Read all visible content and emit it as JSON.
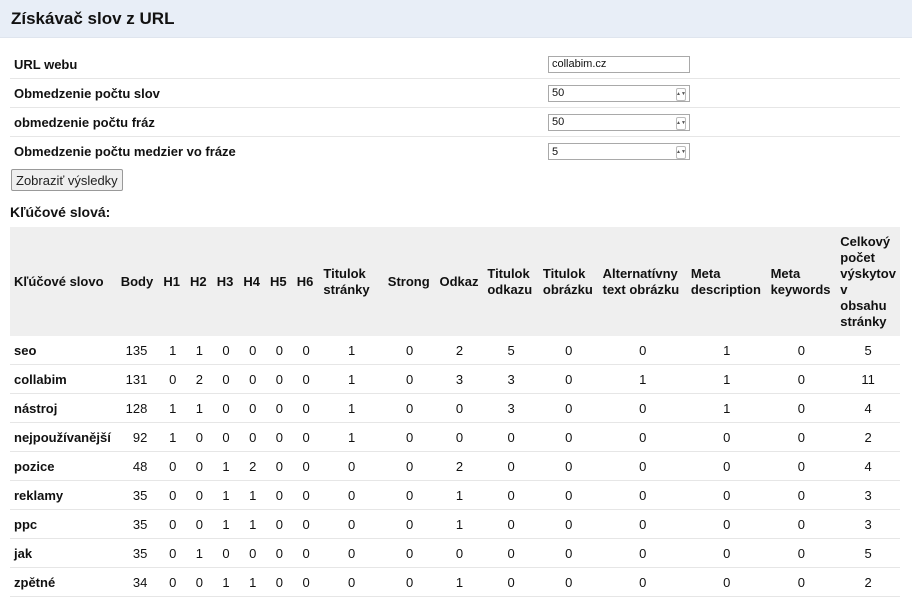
{
  "app": {
    "title": "Získávač slov z URL"
  },
  "form": {
    "rows": [
      {
        "label": "URL webu",
        "value": "collabim.cz",
        "spinner": false
      },
      {
        "label": "Obmedzenie počtu slov",
        "value": "50",
        "spinner": true
      },
      {
        "label": "obmedzenie počtu fráz",
        "value": "50",
        "spinner": true
      },
      {
        "label": "Obmedzenie počtu medzier vo fráze",
        "value": "5",
        "spinner": true
      }
    ],
    "submit_label": "Zobraziť výsledky"
  },
  "keywords": {
    "title": "Kľúčové slová:",
    "columns": [
      "Kľúčové slovo",
      "Body",
      "H1",
      "H2",
      "H3",
      "H4",
      "H5",
      "H6",
      "Titulok stránky",
      "Strong",
      "Odkaz",
      "Titulok odkazu",
      "Titulok obrázku",
      "Alternatívny text obrázku",
      "Meta description",
      "Meta keywords",
      "Celkový počet výskytov v obsahu stránky"
    ],
    "rows": [
      [
        "seo",
        "135",
        "1",
        "1",
        "0",
        "0",
        "0",
        "0",
        "1",
        "0",
        "2",
        "5",
        "0",
        "0",
        "1",
        "0",
        "5"
      ],
      [
        "collabim",
        "131",
        "0",
        "2",
        "0",
        "0",
        "0",
        "0",
        "1",
        "0",
        "3",
        "3",
        "0",
        "1",
        "1",
        "0",
        "11"
      ],
      [
        "nástroj",
        "128",
        "1",
        "1",
        "0",
        "0",
        "0",
        "0",
        "1",
        "0",
        "0",
        "3",
        "0",
        "0",
        "1",
        "0",
        "4"
      ],
      [
        "nejpoužívanější",
        "92",
        "1",
        "0",
        "0",
        "0",
        "0",
        "0",
        "1",
        "0",
        "0",
        "0",
        "0",
        "0",
        "0",
        "0",
        "2"
      ],
      [
        "pozice",
        "48",
        "0",
        "0",
        "1",
        "2",
        "0",
        "0",
        "0",
        "0",
        "2",
        "0",
        "0",
        "0",
        "0",
        "0",
        "4"
      ],
      [
        "reklamy",
        "35",
        "0",
        "0",
        "1",
        "1",
        "0",
        "0",
        "0",
        "0",
        "1",
        "0",
        "0",
        "0",
        "0",
        "0",
        "3"
      ],
      [
        "ppc",
        "35",
        "0",
        "0",
        "1",
        "1",
        "0",
        "0",
        "0",
        "0",
        "1",
        "0",
        "0",
        "0",
        "0",
        "0",
        "3"
      ],
      [
        "jak",
        "35",
        "0",
        "1",
        "0",
        "0",
        "0",
        "0",
        "0",
        "0",
        "0",
        "0",
        "0",
        "0",
        "0",
        "0",
        "5"
      ],
      [
        "zpětné",
        "34",
        "0",
        "0",
        "1",
        "1",
        "0",
        "0",
        "0",
        "0",
        "1",
        "0",
        "0",
        "0",
        "0",
        "0",
        "2"
      ]
    ]
  },
  "colors": {
    "header_bg": "#e8eef7",
    "table_header_bg": "#efefef"
  }
}
